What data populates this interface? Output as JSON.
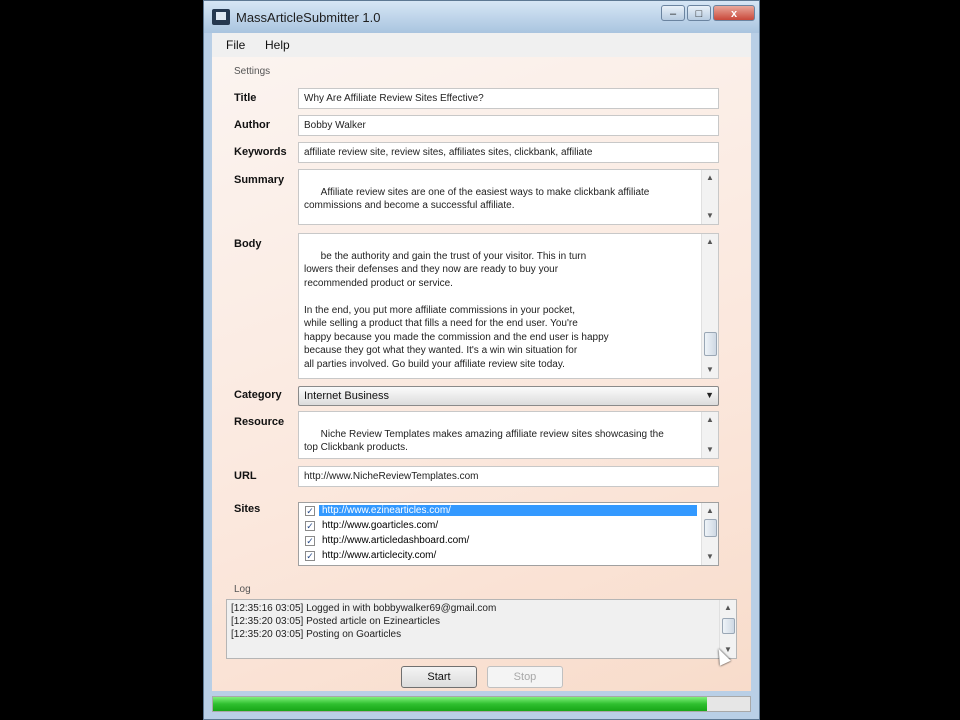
{
  "window": {
    "title": "MassArticleSubmitter 1.0",
    "controls": {
      "minimize": "–",
      "maximize": "□",
      "close": "x"
    }
  },
  "menu": [
    "File",
    "Help"
  ],
  "settings": {
    "group_label": "Settings",
    "title": {
      "label": "Title",
      "value": "Why Are Affiliate Review Sites Effective?"
    },
    "author": {
      "label": "Author",
      "value": "Bobby Walker"
    },
    "keywords": {
      "label": "Keywords",
      "value": "affiliate review site, review sites, affiliates sites, clickbank, affiliate"
    },
    "summary": {
      "label": "Summary",
      "value": "Affiliate review sites are one of the easiest ways to make clickbank affiliate\ncommissions and become a successful affiliate."
    },
    "body": {
      "label": "Body",
      "value": "be the authority and gain the trust of your visitor. This in turn\nlowers their defenses and they now are ready to buy your\nrecommended product or service.\n\nIn the end, you put more affiliate commissions in your pocket,\nwhile selling a product that fills a need for the end user. You're\nhappy because you made the commission and the end user is happy\nbecause they got what they wanted. It's a win win situation for\nall parties involved. Go build your affiliate review site today."
    },
    "category": {
      "label": "Category",
      "value": "Internet Business"
    },
    "resource": {
      "label": "Resource",
      "value": "Niche Review Templates makes amazing affiliate review sites showcasing the\ntop Clickbank products."
    },
    "url": {
      "label": "URL",
      "value": "http://www.NicheReviewTemplates.com"
    },
    "sites": {
      "label": "Sites",
      "items": [
        {
          "text": "http://www.ezinearticles.com/",
          "checked": true,
          "selected": true
        },
        {
          "text": "http://www.goarticles.com/",
          "checked": true,
          "selected": false
        },
        {
          "text": "http://www.articledashboard.com/",
          "checked": true,
          "selected": false
        },
        {
          "text": "http://www.articlecity.com/",
          "checked": true,
          "selected": false
        }
      ]
    }
  },
  "log": {
    "label": "Log",
    "lines": [
      "[12:35:16 03:05] Logged in with bobbywalker69@gmail.com",
      "[12:35:20 03:05] Posted article on Ezinearticles",
      "[12:35:20 03:05] Posting on Goarticles"
    ]
  },
  "buttons": {
    "start": "Start",
    "stop": "Stop"
  },
  "progress": {
    "fraction": 0.92
  },
  "colors": {
    "progress": "#2fbf2f",
    "selection": "#3399ff"
  },
  "icons": {
    "checkbox": "✓",
    "scroll_up": "▲",
    "scroll_down": "▼",
    "dropdown": "▼"
  }
}
